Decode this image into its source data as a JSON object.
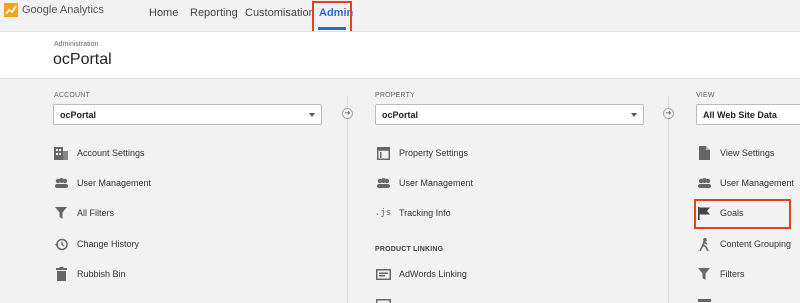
{
  "app": {
    "name": "Google Analytics"
  },
  "nav": {
    "home": "Home",
    "reporting": "Reporting",
    "customisation": "Customisation",
    "admin": "Admin"
  },
  "header": {
    "label": "Administration",
    "title": "ocPortal"
  },
  "account": {
    "label": "ACCOUNT",
    "selected": "ocPortal",
    "items": [
      {
        "label": "Account Settings",
        "icon": "building-icon"
      },
      {
        "label": "User Management",
        "icon": "users-icon"
      },
      {
        "label": "All Filters",
        "icon": "filter-icon"
      },
      {
        "label": "Change History",
        "icon": "history-icon"
      },
      {
        "label": "Rubbish Bin",
        "icon": "trash-icon"
      }
    ]
  },
  "property": {
    "label": "PROPERTY",
    "selected": "ocPortal",
    "items": [
      {
        "label": "Property Settings",
        "icon": "window-icon"
      },
      {
        "label": "User Management",
        "icon": "users-icon"
      },
      {
        "label": "Tracking Info",
        "icon": "js-icon"
      }
    ],
    "section": "PRODUCT LINKING",
    "linking": [
      {
        "label": "AdWords Linking",
        "icon": "adwords-icon"
      }
    ]
  },
  "view": {
    "label": "VIEW",
    "selected": "All Web Site Data",
    "items": [
      {
        "label": "View Settings",
        "icon": "document-icon"
      },
      {
        "label": "User Management",
        "icon": "users-icon"
      },
      {
        "label": "Goals",
        "icon": "flag-icon"
      },
      {
        "label": "Content Grouping",
        "icon": "walker-icon"
      },
      {
        "label": "Filters",
        "icon": "filter-icon"
      }
    ]
  },
  "colors": {
    "accent": "#2a6ecc",
    "highlight": "#e0421a",
    "icon": "#666666"
  }
}
